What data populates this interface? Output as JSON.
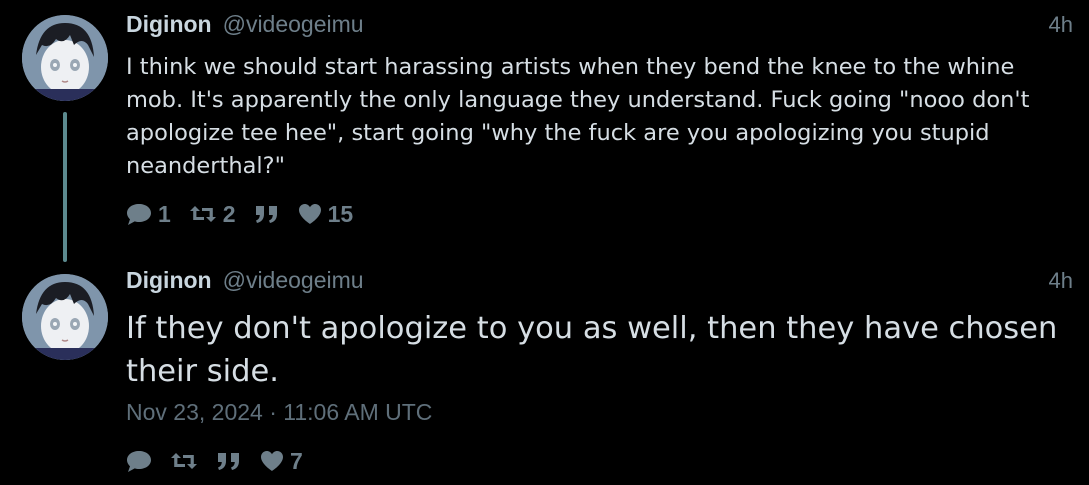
{
  "thread": {
    "tweets": [
      {
        "author_name": "Diginon",
        "author_handle": "@videogeimu",
        "time": "4h",
        "text": "I think we should start harassing artists when they bend the knee to the whine mob. It's apparently the only language they understand. Fuck going \"nooo don't apologize tee hee\", start going \"why the fuck are you apologizing you stupid neanderthal?\"",
        "actions": {
          "reply_icon": "speech-bubble-icon",
          "reply_count": "1",
          "retweet_icon": "retweet-icon",
          "retweet_count": "2",
          "quote_icon": "quote-icon",
          "like_icon": "heart-icon",
          "like_count": "15"
        }
      },
      {
        "author_name": "Diginon",
        "author_handle": "@videogeimu",
        "time": "4h",
        "text": "If they don't apologize to you as well, then they have chosen their side.",
        "date": "Nov 23, 2024 · 11:06 AM UTC",
        "actions": {
          "reply_icon": "speech-bubble-icon",
          "retweet_icon": "retweet-icon",
          "quote_icon": "quote-icon",
          "like_icon": "heart-icon",
          "like_count": "7"
        }
      }
    ]
  },
  "colors": {
    "background": "#000000",
    "name": "#c9d6df",
    "muted": "#6e7f8a",
    "text": "#d6dee4",
    "thread_line": "#5c8a8f"
  }
}
